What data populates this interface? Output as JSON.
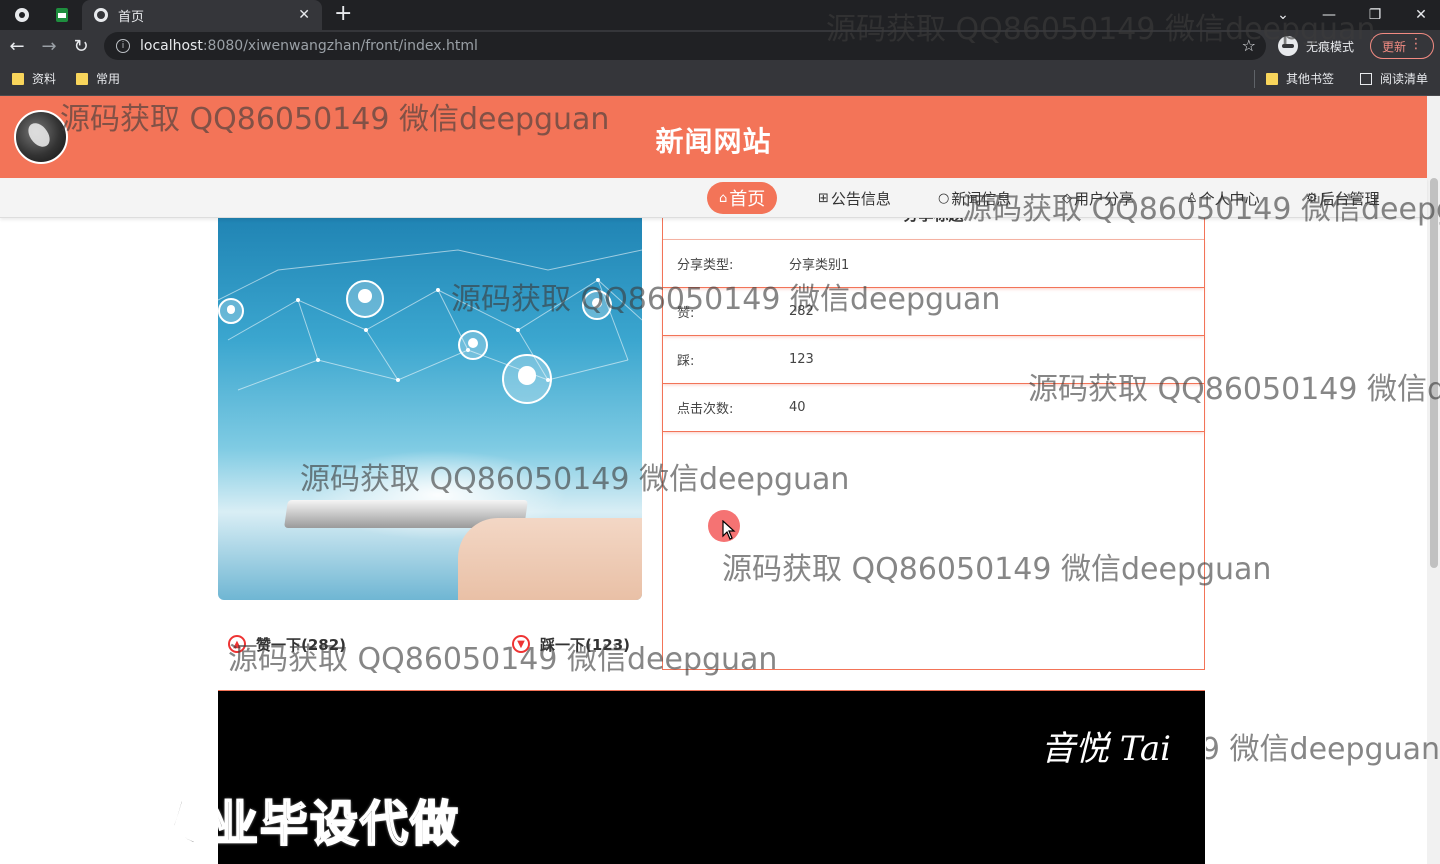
{
  "browser": {
    "tab_title": "首页",
    "url_host": "localhost",
    "url_path": ":8080/xiwenwangzhan/front/index.html",
    "incognito_label": "无痕模式",
    "update_label": "更新",
    "bookmarks": [
      "资料",
      "常用"
    ],
    "bookmarks_right": [
      "其他书签",
      "阅读清单"
    ]
  },
  "site": {
    "title": "新闻网站",
    "nav": [
      "首页",
      "公告信息",
      "新闻信息",
      "用户分享",
      "个人中心",
      "后台管理"
    ]
  },
  "detail": {
    "title": "分享标题",
    "rows": [
      {
        "label": "分享类型:",
        "value": "分享类别1"
      },
      {
        "label": "赞:",
        "value": "282"
      },
      {
        "label": "踩:",
        "value": "123"
      },
      {
        "label": "点击次数:",
        "value": "40"
      }
    ],
    "like_label": "赞一下(282)",
    "dislike_label": "踩一下(123)"
  },
  "video": {
    "signature": "音悦 Tai"
  },
  "promo_text": "专业毕设代做",
  "watermark": "源码获取 QQ86050149 微信deepguan",
  "colors": {
    "accent": "#f37458",
    "chrome": "#202124"
  }
}
